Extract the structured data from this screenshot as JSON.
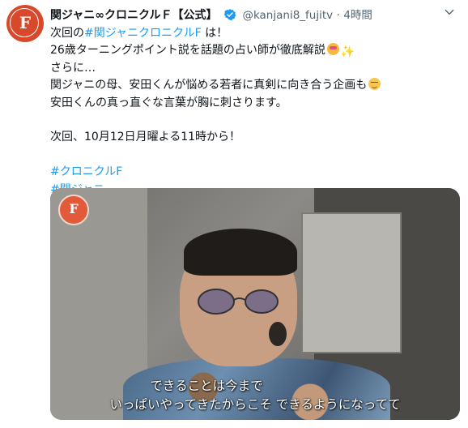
{
  "tweet": {
    "display_name": "関ジャニ∞クロニクルＦ【公式】",
    "handle": "@kanjani8_fujitv",
    "separator": "·",
    "timestamp": "4時間",
    "more_icon": "chevron-down-icon",
    "avatar_letter": "F",
    "lines": [
      {
        "pre": "次回の",
        "tag": "#関ジャニクロニクルF",
        "post": " は！"
      },
      {
        "text": "26歳ターニングポイント説を話題の占い師が徹底解説"
      },
      {
        "text": "さらに…"
      },
      {
        "text": "関ジャニの母、安田くんが悩める若者に真剣に向き合う企画も"
      },
      {
        "text": "安田くんの真っ直ぐな言葉が胸に刺さります。"
      },
      {
        "text": "次回、10月12日月曜よる11時から！"
      }
    ],
    "hashtags": [
      "#クロニクルF",
      "#関ジャニ"
    ],
    "sparkles": "✨",
    "colors": {
      "link": "#1d9bf0",
      "verified": "#1d9bf0",
      "muted": "#536471",
      "text": "#0f1419"
    }
  },
  "media": {
    "logo_letter": "F",
    "subtitle_line1": "できることは今まで",
    "subtitle_line2": "いっぱいやってきたからこそ できるようになってて"
  }
}
